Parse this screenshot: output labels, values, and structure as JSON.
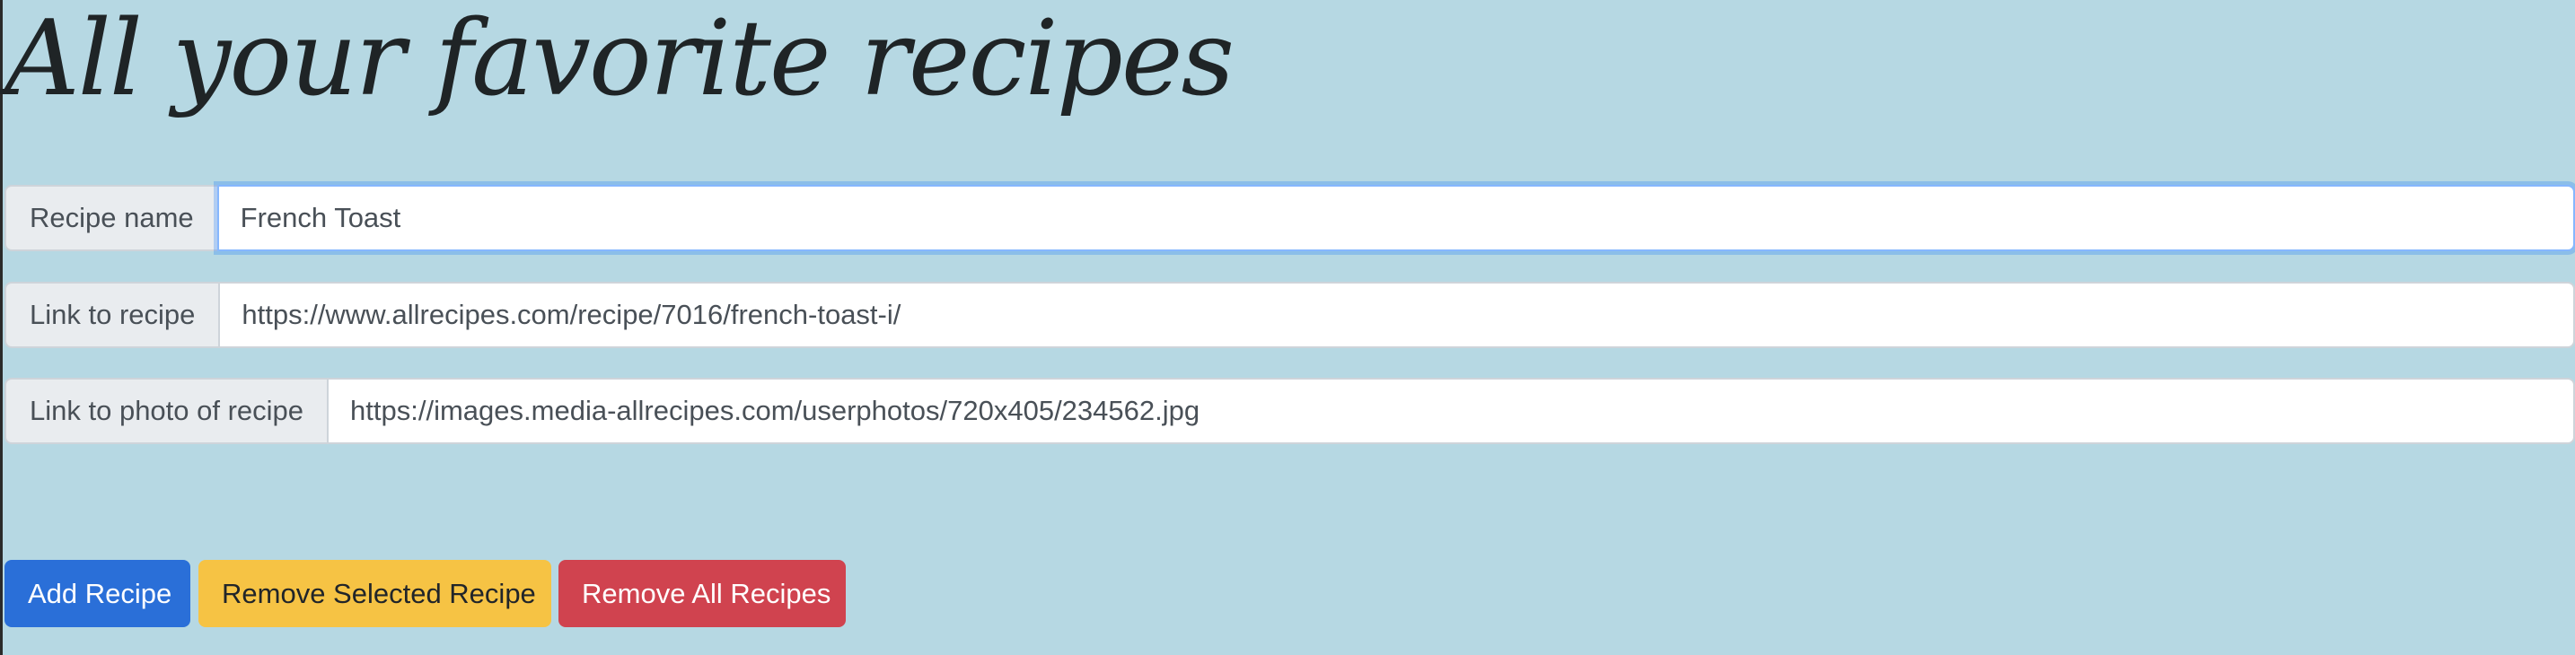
{
  "page": {
    "title": "All your favorite recipes"
  },
  "form": {
    "recipe_name": {
      "label": "Recipe name",
      "value": "French Toast"
    },
    "recipe_link": {
      "label": "Link to recipe",
      "value": "https://www.allrecipes.com/recipe/7016/french-toast-i/"
    },
    "photo_link": {
      "label": "Link to photo of recipe",
      "value": "https://images.media-allrecipes.com/userphotos/720x405/234562.jpg"
    }
  },
  "actions": {
    "add_label": "Add Recipe",
    "remove_selected_label": "Remove Selected Recipe",
    "remove_all_label": "Remove All Recipes"
  },
  "colors": {
    "background": "#b6d8e3",
    "primary": "#2a6fd8",
    "warning": "#f6c344",
    "danger": "#d0434f",
    "focus_ring": "#86b7fe"
  }
}
